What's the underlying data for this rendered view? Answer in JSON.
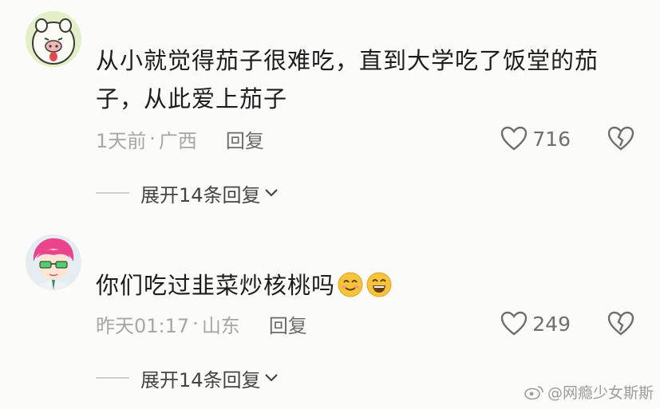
{
  "comments": [
    {
      "text": "从小就觉得茄子很难吃，直到大学吃了饭堂的茄子，从此爱上茄子",
      "time": "1天前",
      "separator": "·",
      "location": "广西",
      "reply_label": "回复",
      "likes": "716",
      "expand_label": "展开14条回复",
      "avatar": "pig-avatar"
    },
    {
      "text": "你们吃过韭菜炒核桃吗",
      "time": "昨天01:17",
      "separator": "·",
      "location": "山东",
      "reply_label": "回复",
      "likes": "249",
      "expand_label": "展开14条回复",
      "avatar": "pink-hair-anime-avatar",
      "emojis": [
        "smile-emoji",
        "grin-emoji"
      ]
    }
  ],
  "watermark": "@网瘾少女斯斯",
  "colors": {
    "text": "#1d1d1d",
    "meta": "#a7a7a7",
    "accent_emoji": "#f6c33c"
  }
}
